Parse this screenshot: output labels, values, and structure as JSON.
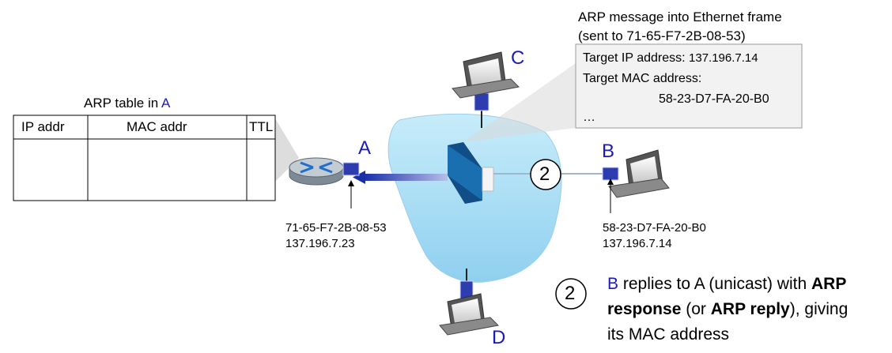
{
  "message_caption": {
    "line1": "ARP message into Ethernet frame",
    "line2": "(sent to 71-65-F7-2B-08-53)"
  },
  "message_box": {
    "target_ip_label": "Target IP address:",
    "target_ip_value": "137.196.7.14",
    "target_mac_label": "Target MAC address:",
    "target_mac_value": "58-23-D7-FA-20-B0",
    "ellipsis": "…"
  },
  "arp_table": {
    "title_prefix": "ARP table in",
    "title_node": "A",
    "columns": [
      "IP addr",
      "MAC addr",
      "TTL"
    ]
  },
  "nodes": {
    "A": {
      "label": "A",
      "mac": "71-65-F7-2B-08-53",
      "ip": "137.196.7.23"
    },
    "B": {
      "label": "B",
      "mac": "58-23-D7-FA-20-B0",
      "ip": "137.196.7.14"
    },
    "C": {
      "label": "C"
    },
    "D": {
      "label": "D"
    }
  },
  "step": {
    "number": "2",
    "node": "B",
    "text1": "replies to A (unicast) with",
    "bold1": "ARP",
    "bold2": "response",
    "text2": "(or",
    "bold3": "ARP reply",
    "text3": "), giving",
    "text4": "its MAC address"
  },
  "colors": {
    "node_label": "#1a1ab8",
    "lan_cloud": "#a8dcf2",
    "switch": "#1a6fb0",
    "box_fill": "#f2f2f2"
  }
}
